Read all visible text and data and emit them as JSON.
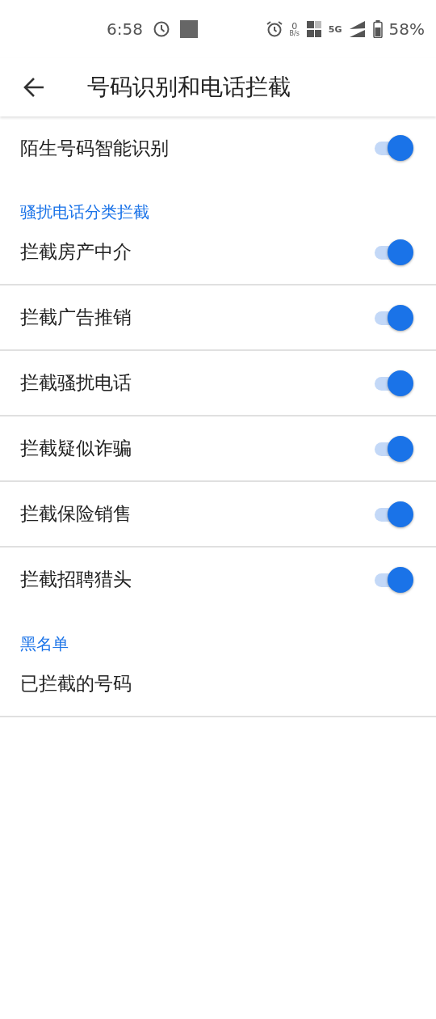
{
  "status_bar": {
    "time": "6:58",
    "net_speed": "0",
    "net_unit": "B/s",
    "network": "5G",
    "battery": "58%"
  },
  "toolbar": {
    "title": "号码识别和电话拦截"
  },
  "settings": [
    {
      "kind": "switch",
      "label": "陌生号码智能识别",
      "on": true
    },
    {
      "kind": "header",
      "label": "骚扰电话分类拦截"
    },
    {
      "kind": "switch",
      "label": "拦截房产中介",
      "on": true
    },
    {
      "kind": "switch",
      "label": "拦截广告推销",
      "on": true
    },
    {
      "kind": "switch",
      "label": "拦截骚扰电话",
      "on": true
    },
    {
      "kind": "switch",
      "label": "拦截疑似诈骗",
      "on": true
    },
    {
      "kind": "switch",
      "label": "拦截保险销售",
      "on": true
    },
    {
      "kind": "switch",
      "label": "拦截招聘猎头",
      "on": true
    },
    {
      "kind": "header",
      "label": "黑名单"
    },
    {
      "kind": "link",
      "label": "已拦截的号码"
    }
  ]
}
